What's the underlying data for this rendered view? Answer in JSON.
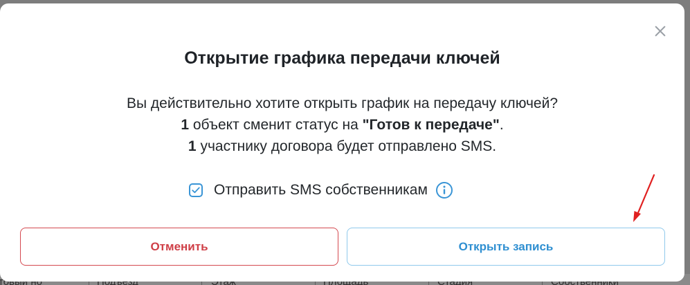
{
  "dialog": {
    "title": "Открытие графика передачи ключей",
    "message": {
      "line1": "Вы действительно хотите открыть график на передачу ключей?",
      "line2_count": "1",
      "line2_text": " объект сменит статус на ",
      "line2_status": "\"Готов к передаче\"",
      "line2_end": ".",
      "line3_count": "1",
      "line3_text": " участнику договора будет отправлено SMS."
    },
    "checkbox": {
      "label": "Отправить SMS собственникам",
      "checked": true
    },
    "buttons": {
      "cancel": "Отменить",
      "open": "Открыть запись"
    }
  },
  "background_table": {
    "columns": [
      "товый но",
      "Подъезд",
      "Этаж",
      "Площадь",
      "Стадия",
      "Собственники"
    ]
  },
  "colors": {
    "accent": "#3a95d6",
    "danger": "#d4484f",
    "annotation_arrow": "#e02020"
  }
}
